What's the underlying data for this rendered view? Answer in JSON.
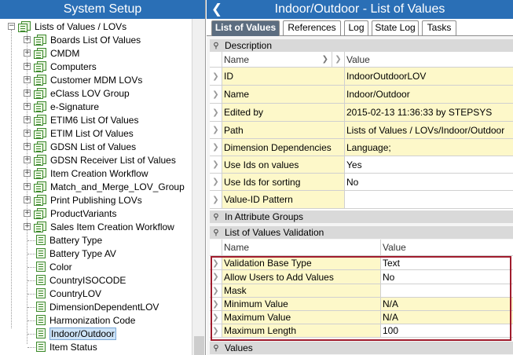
{
  "left_panel": {
    "title": "System Setup",
    "root": "Lists of Values / LOVs",
    "folders": [
      "Boards List Of Values",
      "CMDM",
      "Computers",
      "Customer MDM LOVs",
      "eClass LOV Group",
      "e-Signature",
      "ETIM6 List Of Values",
      "ETIM List Of Values",
      "GDSN List of Values",
      "GDSN Receiver List of Values",
      "Item Creation Workflow",
      "Match_and_Merge_LOV_Group",
      "Print Publishing LOVs",
      "ProductVariants",
      "Sales Item Creation Workflow"
    ],
    "lists": [
      "Battery Type",
      "Battery Type AV",
      "Color",
      "CountryISOCODE",
      "CountryLOV",
      "DimensionDependentLOV",
      "Harmonization Code",
      "Indoor/Outdoor",
      "Item Status"
    ],
    "selected": "Indoor/Outdoor"
  },
  "right_panel": {
    "title": "Indoor/Outdoor - List of Values",
    "tabs": [
      "List of Values",
      "References",
      "Log",
      "State Log",
      "Tasks"
    ],
    "active_tab": "List of Values",
    "description": {
      "section_label": "Description",
      "col_name": "Name",
      "col_value": "Value",
      "rows": [
        {
          "name": "ID",
          "value": "IndoorOutdoorLOV"
        },
        {
          "name": "Name",
          "value": "Indoor/Outdoor"
        },
        {
          "name": "Edited by",
          "value": "2015-02-13 11:36:33 by STEPSYS"
        },
        {
          "name": "Path",
          "value": "Lists of Values / LOVs/Indoor/Outdoor"
        },
        {
          "name": "Dimension Dependencies",
          "value": "Language;"
        },
        {
          "name": "Use Ids on values",
          "value": "Yes"
        },
        {
          "name": "Use Ids for sorting",
          "value": "No"
        },
        {
          "name": "Value-ID Pattern",
          "value": ""
        }
      ]
    },
    "in_attribute_groups": {
      "section_label": "In Attribute Groups"
    },
    "validation": {
      "section_label": "List of Values Validation",
      "col_name": "Name",
      "col_value": "Value",
      "rows": [
        {
          "name": "Validation Base Type",
          "value": "Text"
        },
        {
          "name": "Allow Users to Add Values",
          "value": "No"
        },
        {
          "name": "Mask",
          "value": ""
        },
        {
          "name": "Minimum Value",
          "value": "N/A"
        },
        {
          "name": "Maximum Value",
          "value": "N/A"
        },
        {
          "name": "Maximum Length",
          "value": "100"
        }
      ]
    },
    "values": {
      "section_label": "Values"
    }
  },
  "colors": {
    "header_blue": "#2a6fb6",
    "active_tab": "#5c6d80",
    "row_yellow": "#fdf8c9",
    "highlight_red": "#a01c2d"
  }
}
